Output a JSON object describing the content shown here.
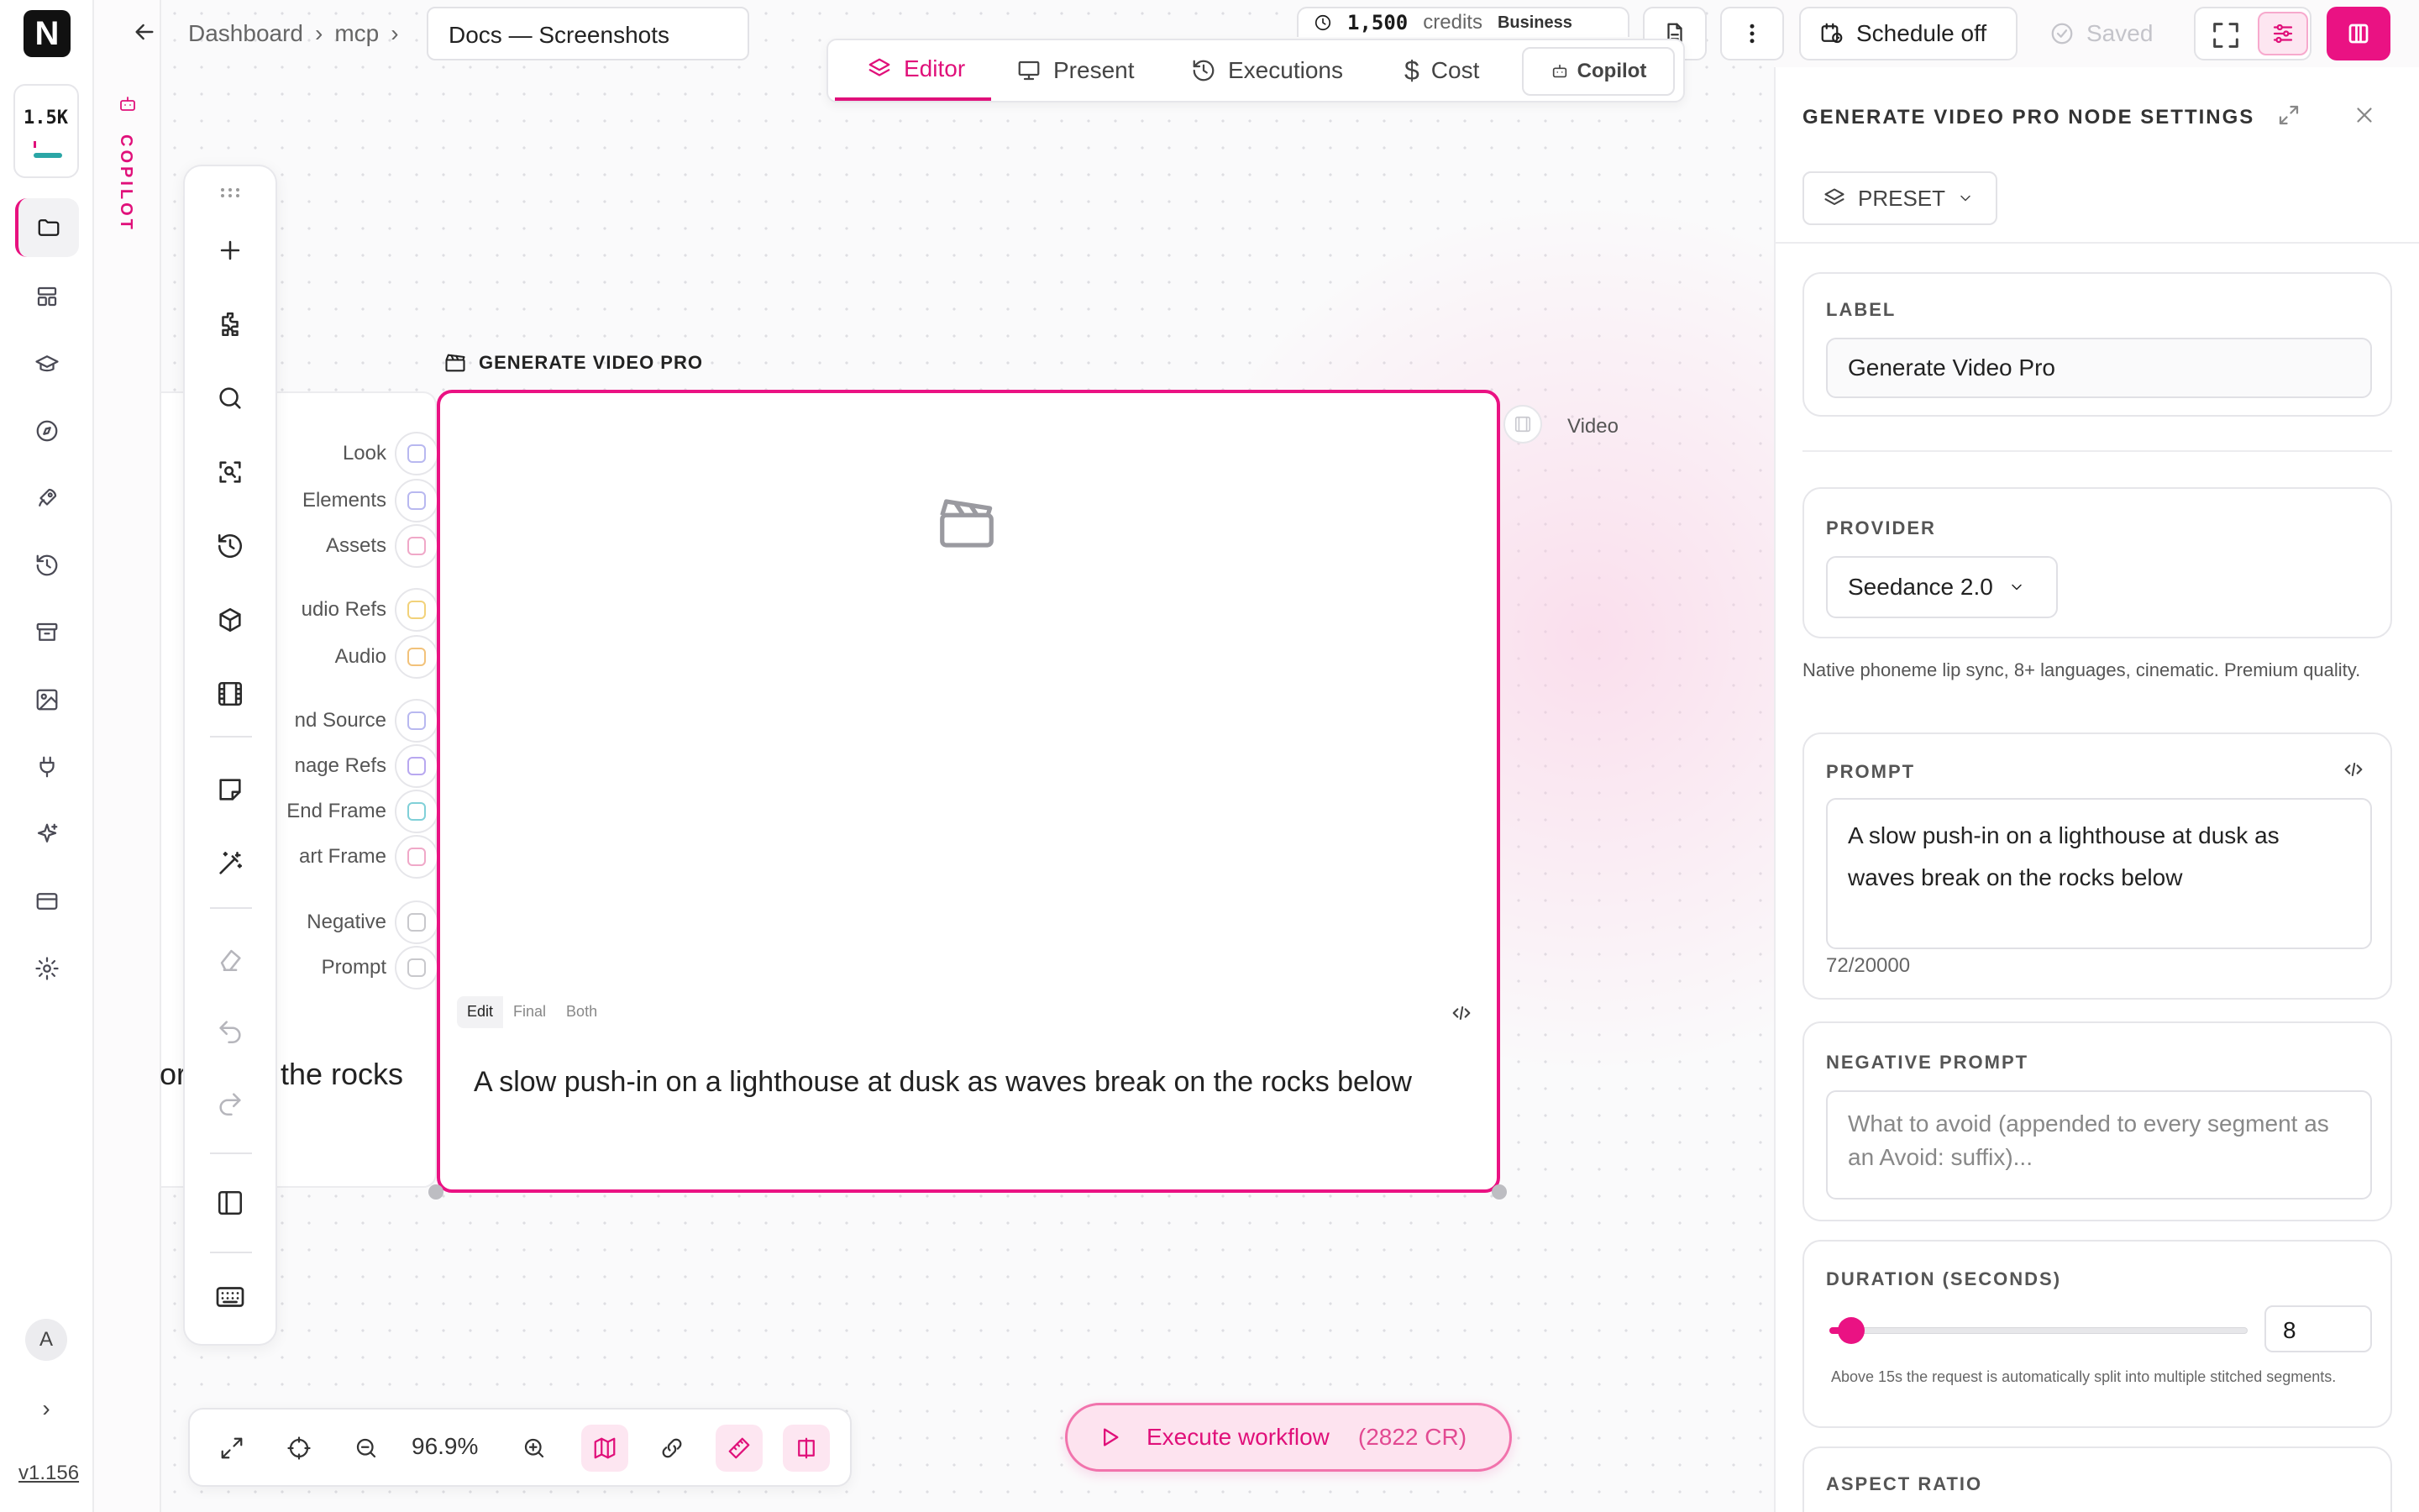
{
  "app": {
    "logo_letter": "N",
    "credits_short": "1.5K",
    "version": "v1.156",
    "avatar_initial": "A",
    "copilot_label": "COPILOT"
  },
  "colors": {
    "accent": "#ea1283",
    "teal": "#2aa6a6"
  },
  "rail": {
    "items": [
      {
        "name": "folder-icon",
        "active": true
      },
      {
        "name": "layout-icon"
      },
      {
        "name": "graduation-cap-icon"
      },
      {
        "name": "compass-icon"
      },
      {
        "name": "rocket-icon"
      },
      {
        "name": "history-icon"
      },
      {
        "name": "archive-icon"
      },
      {
        "name": "image-gallery-icon"
      },
      {
        "name": "plug-icon"
      },
      {
        "name": "sparkles-icon"
      },
      {
        "name": "credit-card-icon"
      },
      {
        "name": "settings-gear-icon"
      }
    ]
  },
  "header": {
    "breadcrumb": [
      "Dashboard",
      "mcp"
    ],
    "doc_title": "Docs — Screenshots",
    "credits_value": "1,500",
    "credits_unit": "credits",
    "plan": "Business",
    "schedule_label": "Schedule off",
    "saved_label": "Saved"
  },
  "tabs": [
    {
      "label": "Editor",
      "icon": "layers-icon",
      "active": true
    },
    {
      "label": "Present",
      "icon": "monitor-icon"
    },
    {
      "label": "Executions",
      "icon": "history-icon"
    },
    {
      "label": "Cost",
      "icon": "dollar-icon"
    }
  ],
  "copilot_tab": "Copilot",
  "node": {
    "title": "GENERATE VIDEO PRO",
    "inputs": [
      {
        "label": "Look",
        "color": "#b8b8f0"
      },
      {
        "label": "Elements",
        "color": "#b8b8f0"
      },
      {
        "label": "Assets",
        "color": "#f0a8c8"
      },
      {
        "label": "udio Refs",
        "color": "#f2d27a"
      },
      {
        "label": "Audio",
        "color": "#f2c27a"
      },
      {
        "label": "nd Source",
        "color": "#b8b8f0"
      },
      {
        "label": "nage Refs",
        "color": "#b8a8f0"
      },
      {
        "label": "End Frame",
        "color": "#80d0d8"
      },
      {
        "label": "art Frame",
        "color": "#f0a8c8"
      },
      {
        "label": "Negative",
        "color": "#c8c8cc"
      },
      {
        "label": "Prompt",
        "color": "#c8c8cc"
      }
    ],
    "output_label": "Video",
    "view_tabs": [
      "Edit",
      "Final",
      "Both"
    ],
    "prompt_text": "A slow push-in on a lighthouse at dusk as waves break on the rocks below",
    "prev_node_text_a": "or",
    "prev_node_text_b": "the rocks"
  },
  "zoom": {
    "value": "96.9%"
  },
  "execute": {
    "label": "Execute workflow",
    "cost": "(2822 CR)"
  },
  "panel": {
    "title": "GENERATE VIDEO PRO NODE SETTINGS",
    "preset_label": "PRESET",
    "label_heading": "LABEL",
    "label_value": "Generate Video Pro",
    "provider_heading": "PROVIDER",
    "provider_value": "Seedance 2.0",
    "provider_desc": "Native phoneme lip sync, 8+ languages, cinematic. Premium quality.",
    "prompt_heading": "PROMPT",
    "prompt_value": "A slow push-in on a lighthouse at dusk as waves break on the rocks below",
    "prompt_count": "72/20000",
    "negative_heading": "NEGATIVE PROMPT",
    "negative_placeholder": "What to avoid (appended to every segment as an Avoid: suffix)...",
    "duration_heading": "DURATION (SECONDS)",
    "duration_value": "8",
    "duration_fraction": 0.04,
    "duration_help": "Above 15s the request is automatically split into multiple stitched segments.",
    "aspect_heading": "ASPECT RATIO"
  }
}
